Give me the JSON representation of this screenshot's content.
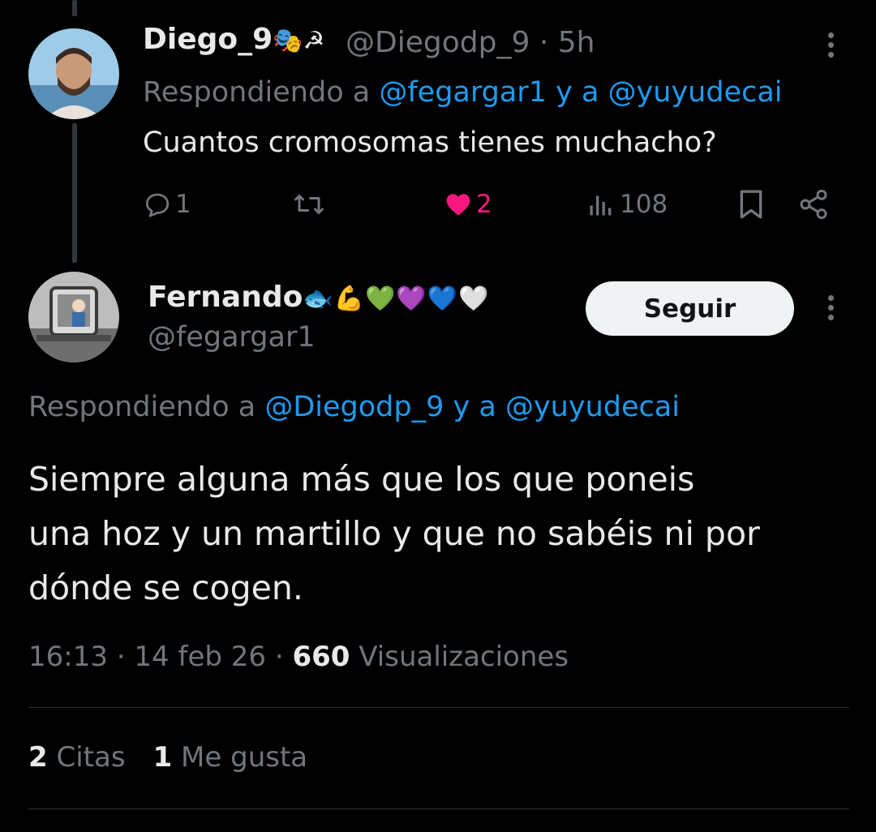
{
  "reply": {
    "display_name": "Diego_9",
    "name_emojis": "🎭☭",
    "handle": "@Diegodp_9",
    "separator": "·",
    "time": "5h",
    "replying_prefix": "Respondiendo a",
    "mention_1": "@fegargar1",
    "conjunction": "y a",
    "mention_2": "@yuyudecai",
    "text": "Cuantos cromosomas tienes muchacho?",
    "actions": {
      "reply_count": "1",
      "retweet_count": "",
      "like_count": "2",
      "views_count": "108"
    }
  },
  "main": {
    "display_name": "Fernando",
    "name_emojis": "🐟💪💚💜💙🤍",
    "handle": "@fegargar1",
    "follow_label": "Seguir",
    "replying_prefix": "Respondiendo a",
    "mention_1": "@Diegodp_9",
    "conjunction": "y a",
    "mention_2": "@yuyudecai",
    "text_lines": [
      "Siempre alguna más que los que poneis",
      "una hoz y un martillo y que no sabéis ni por",
      "dónde se cogen."
    ],
    "meta": {
      "time": "16:13",
      "dot": "·",
      "date": "14 feb 26",
      "views": "660",
      "views_label": "Visualizaciones"
    },
    "stats": {
      "quotes_count": "2",
      "quotes_label": "Citas",
      "likes_count": "1",
      "likes_label": "Me gusta"
    }
  },
  "colors": {
    "background": "#000000",
    "text_primary": "#e7e9ea",
    "text_secondary": "#71767b",
    "link": "#1d9bf0",
    "like": "#f91880",
    "divider": "#2f3336"
  }
}
